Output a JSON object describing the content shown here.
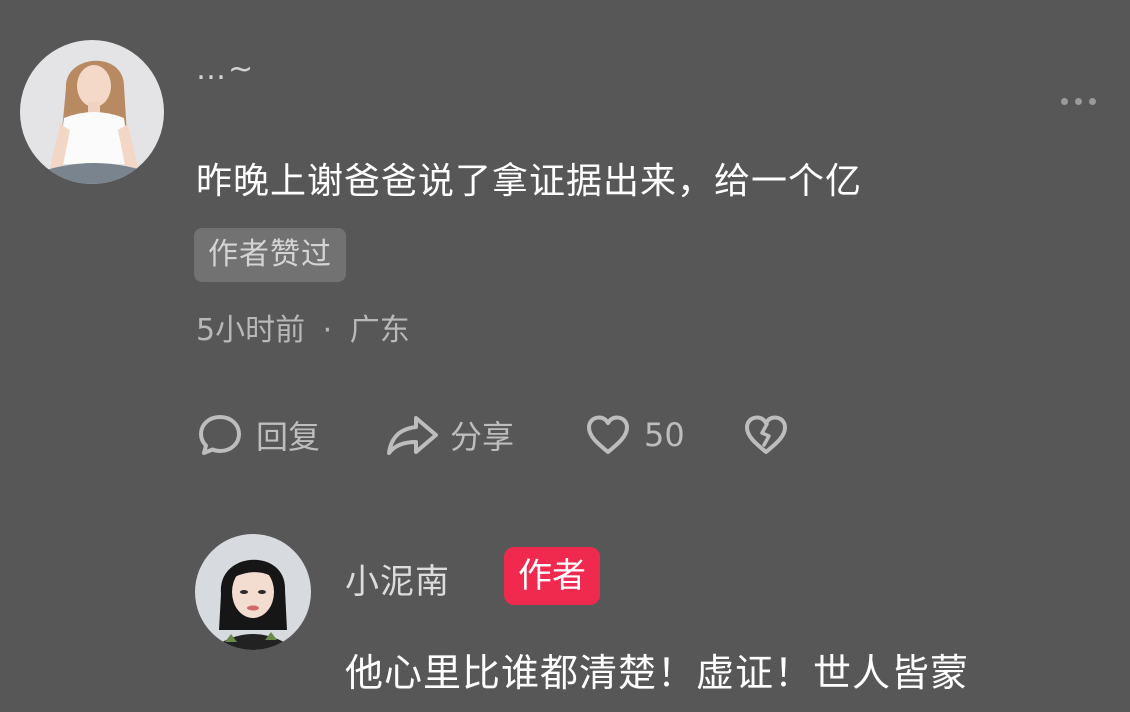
{
  "comment": {
    "username": "…~",
    "text": "昨晚上谢爸爸说了拿证据出来，给一个亿",
    "badge": "作者赞过",
    "time": "5小时前",
    "separator": "·",
    "location": "广东",
    "actions": {
      "reply_label": "回复",
      "share_label": "分享",
      "like_count": "50"
    },
    "icons": [
      "more-icon",
      "comment-bubble-icon",
      "share-arrow-icon",
      "heart-icon",
      "broken-heart-icon"
    ]
  },
  "reply": {
    "username": "小泥南",
    "author_badge": "作者",
    "text": "他心里比谁都清楚！虚证！世人皆蒙"
  },
  "colors": {
    "background": "#575757",
    "author_badge": "#f0294f",
    "liked_badge": "#727272"
  }
}
